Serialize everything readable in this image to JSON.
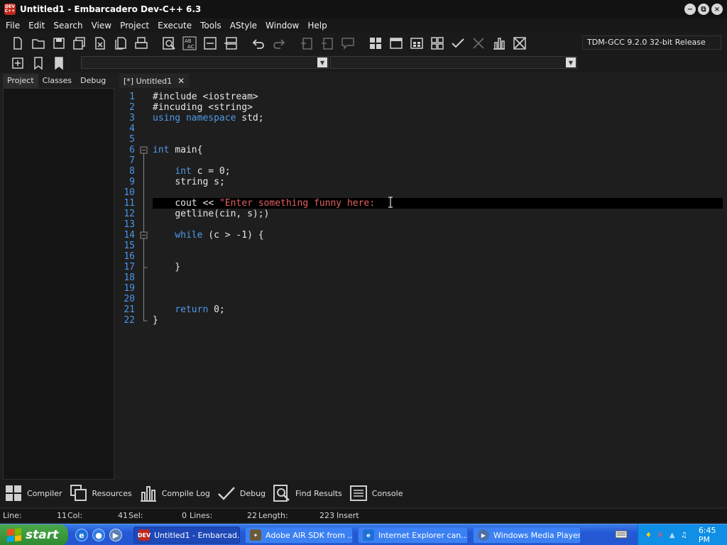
{
  "window": {
    "title": "Untitled1 - Embarcadero Dev-C++ 6.3",
    "app_icon_text": "DEV\nC++",
    "controls": [
      "minimize",
      "restore",
      "close"
    ]
  },
  "menu": {
    "items": [
      "File",
      "Edit",
      "Search",
      "View",
      "Project",
      "Execute",
      "Tools",
      "AStyle",
      "Window",
      "Help"
    ]
  },
  "toolbar": {
    "compiler": "TDM-GCC 9.2.0 32-bit Release"
  },
  "left_panel": {
    "tabs": [
      "Project",
      "Classes",
      "Debug"
    ],
    "active_tab": "Project"
  },
  "editor": {
    "tab_label": "[*] Untitled1",
    "lines": [
      {
        "n": "1",
        "code": "#include <iostream>"
      },
      {
        "n": "2",
        "code": "#incuding <string>"
      },
      {
        "n": "3",
        "code": "using namespace std;"
      },
      {
        "n": "4",
        "code": ""
      },
      {
        "n": "5",
        "code": ""
      },
      {
        "n": "6",
        "code": "int main{"
      },
      {
        "n": "7",
        "code": ""
      },
      {
        "n": "8",
        "code": "    int c = 0;"
      },
      {
        "n": "9",
        "code": "    string s;"
      },
      {
        "n": "10",
        "code": ""
      },
      {
        "n": "11",
        "code": "    cout << \"Enter something funny here:"
      },
      {
        "n": "12",
        "code": "    getline(cin, s);)"
      },
      {
        "n": "13",
        "code": ""
      },
      {
        "n": "14",
        "code": "    while (c > -1) {"
      },
      {
        "n": "15",
        "code": ""
      },
      {
        "n": "16",
        "code": ""
      },
      {
        "n": "17",
        "code": "    }"
      },
      {
        "n": "18",
        "code": ""
      },
      {
        "n": "19",
        "code": ""
      },
      {
        "n": "20",
        "code": ""
      },
      {
        "n": "21",
        "code": "    return 0;"
      },
      {
        "n": "22",
        "code": "}"
      }
    ],
    "current_line": "11",
    "colors": {
      "keyword": "#4f9ae8",
      "string": "#e26060",
      "line_number": "#4a96e8"
    }
  },
  "bottom_tabs": [
    "Compiler",
    "Resources",
    "Compile Log",
    "Debug",
    "Find Results",
    "Console"
  ],
  "status": {
    "line_label": "Line:",
    "line_value": "11",
    "col_label": "Col:",
    "col_value": "41",
    "sel_label": "Sel:",
    "sel_value": "0",
    "lines_label": "Lines:",
    "lines_value": "22",
    "length_label": "Length:",
    "length_value": "223",
    "mode": "Insert"
  },
  "taskbar": {
    "start_label": "start",
    "buttons": [
      {
        "label": "Untitled1 - Embarcad...",
        "active": true
      },
      {
        "label": "Adobe AIR SDK from ...",
        "active": false
      },
      {
        "label": "Internet Explorer can...",
        "active": false
      },
      {
        "label": "Windows Media Player",
        "active": false
      }
    ],
    "clock": "6:45 PM"
  }
}
